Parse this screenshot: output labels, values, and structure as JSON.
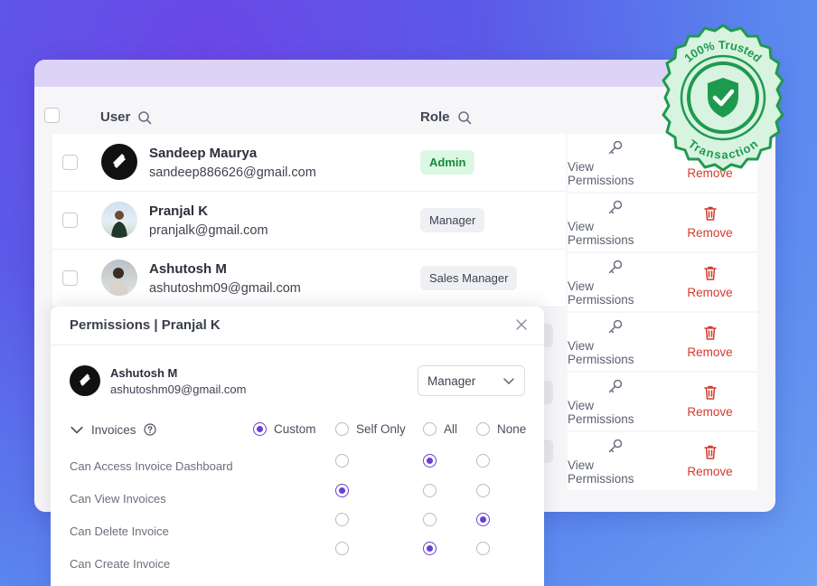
{
  "table": {
    "headers": {
      "user": "User",
      "role": "Role"
    },
    "rows": [
      {
        "name": "Sandeep Maurya",
        "email": "sandeep886626@gmail.com",
        "role": "Admin"
      },
      {
        "name": "Pranjal K",
        "email": "pranjalk@gmail.com",
        "role": "Manager"
      },
      {
        "name": "Ashutosh M",
        "email": "ashutoshm09@gmail.com",
        "role": "Sales Manager"
      }
    ],
    "actions": {
      "view_label": "View Permissions",
      "remove_label": "Remove"
    }
  },
  "modal": {
    "title": "Permissions | Pranjal K",
    "user_name": "Ashutosh M",
    "user_email": "ashutoshm09@gmail.com",
    "role_value": "Manager",
    "section_label": "Invoices",
    "scope_options": [
      "Custom",
      "Self Only",
      "All",
      "None"
    ],
    "scope_selected": "Custom",
    "permissions": [
      {
        "label": "Can Access Invoice Dashboard",
        "selected": "All"
      },
      {
        "label": "Can View Invoices",
        "selected": "Self Only"
      },
      {
        "label": "Can Delete Invoice",
        "selected": "None"
      },
      {
        "label": "Can Create Invoice",
        "selected": "All"
      }
    ]
  },
  "seal": {
    "top_text": "100% Trusted",
    "bottom_text": "Transaction"
  },
  "colors": {
    "accent": "#6a3fd0",
    "remove": "#d23a2c",
    "admin_badge_bg": "#dcf8e3",
    "admin_badge_text": "#158a3a",
    "seal_green": "#1e9a4f"
  },
  "icons": [
    "search-icon",
    "key-icon",
    "trash-icon",
    "close-icon",
    "chevron-down-icon",
    "help-circle-icon",
    "shield-check-icon"
  ]
}
